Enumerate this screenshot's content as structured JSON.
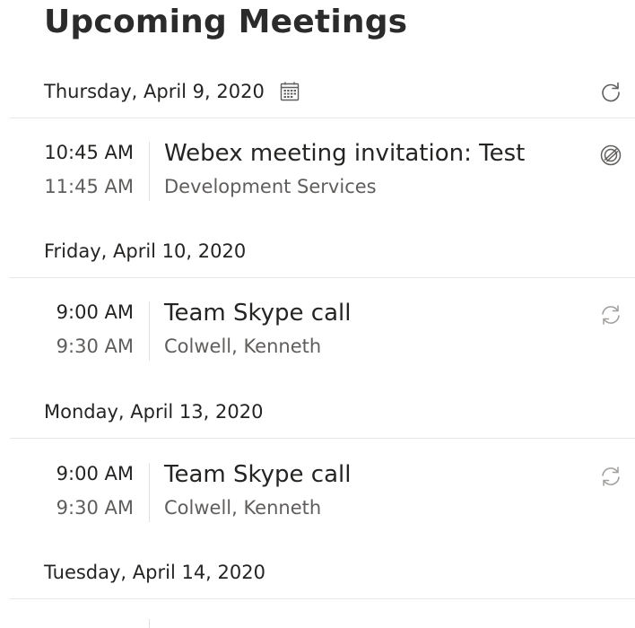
{
  "header": {
    "title": "Upcoming Meetings"
  },
  "days": [
    {
      "label": "Thursday, April 9, 2020",
      "meetings": [
        {
          "start": "10:45 AM",
          "end": "11:45 AM",
          "title": "Webex meeting invitation: Test",
          "subtitle": "Development Services",
          "icon": "webex-icon"
        }
      ]
    },
    {
      "label": "Friday, April 10, 2020",
      "meetings": [
        {
          "start": "9:00 AM",
          "end": "9:30 AM",
          "title": "Team Skype call",
          "subtitle": "Colwell, Kenneth",
          "icon": "recurring-icon"
        }
      ]
    },
    {
      "label": "Monday, April 13, 2020",
      "meetings": [
        {
          "start": "9:00 AM",
          "end": "9:30 AM",
          "title": "Team Skype call",
          "subtitle": "Colwell, Kenneth",
          "icon": "recurring-icon"
        }
      ]
    },
    {
      "label": "Tuesday, April 14, 2020",
      "meetings": []
    }
  ],
  "colors": {
    "text": "#252423",
    "secondary_text": "#605e5c",
    "divider": "#e6e6e6",
    "icon": "#605e5c"
  }
}
